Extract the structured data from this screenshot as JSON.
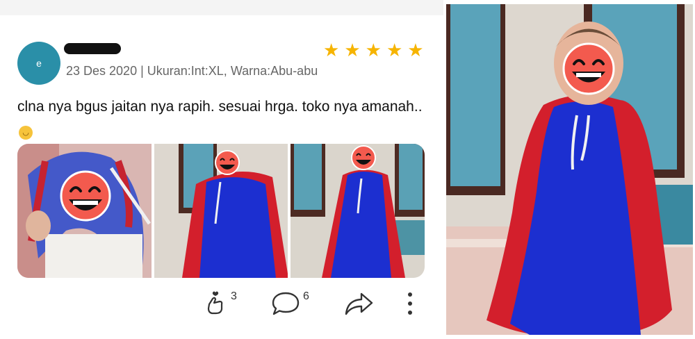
{
  "review": {
    "avatar_letter": "e",
    "meta": "23 Des 2020 | Ukuran:Int:XL, Warna:Abu-abu",
    "rating": 5,
    "text": "clna nya bgus jaitan nya rapih. sesuai hrga.  toko nya amanah..",
    "photos": [
      "review-photo-1",
      "review-photo-2",
      "review-photo-3"
    ]
  },
  "actions": {
    "like_count": "3",
    "comment_count": "6"
  },
  "colors": {
    "star": "#f6b400",
    "avatar": "#2a8fa8",
    "cape_blue": "#1c2fd0",
    "cape_red": "#d31f2c"
  },
  "icons": {
    "like": "finger-heart-icon",
    "comment": "speech-bubble-icon",
    "share": "share-arrow-icon",
    "more": "more-vertical-icon"
  }
}
